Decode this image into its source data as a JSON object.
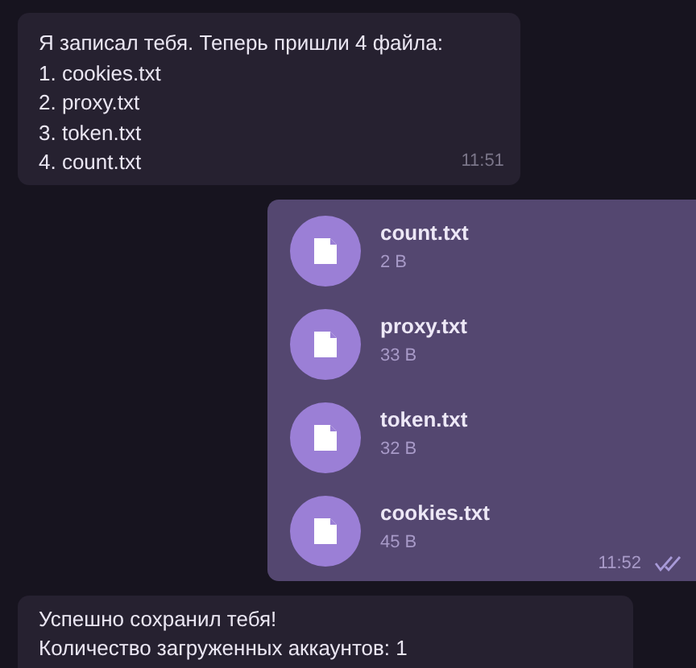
{
  "messages": [
    {
      "kind": "text",
      "lines": [
        "Я записал тебя. Теперь пришли 4 файла:",
        "1. cookies.txt",
        "2. proxy.txt",
        "3. token.txt",
        "4. count.txt"
      ],
      "time": "11:51"
    },
    {
      "kind": "files",
      "read": true,
      "files": [
        {
          "name": "count.txt",
          "size": "2 B"
        },
        {
          "name": "proxy.txt",
          "size": "33 B"
        },
        {
          "name": "token.txt",
          "size": "32 B"
        },
        {
          "name": "cookies.txt",
          "size": "45 B"
        }
      ],
      "time": "11:52"
    },
    {
      "kind": "text",
      "lines": [
        "Успешно сохранил тебя!",
        "Количество загруженных аккаунтов: 1"
      ]
    }
  ]
}
